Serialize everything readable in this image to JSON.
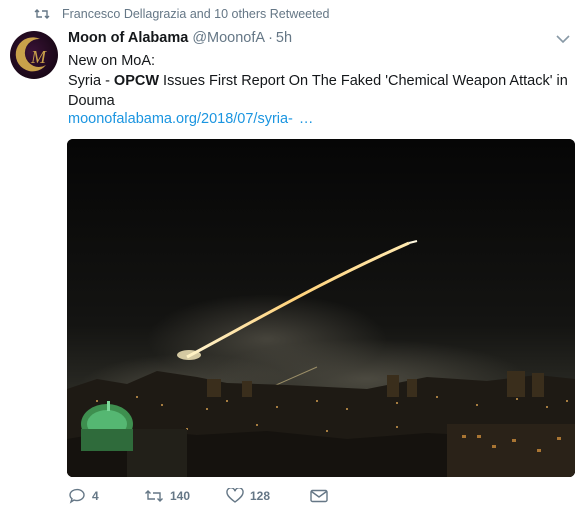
{
  "retweet": {
    "text": "Francesco Dellagrazia and 10 others Retweeted",
    "icon": "retweet-icon"
  },
  "tweet": {
    "display_name": "Moon of Alabama",
    "handle": "@MoonofA",
    "separator": "·",
    "time": "5h",
    "line1": "New on MoA:",
    "line2_prefix": "Syria - ",
    "line2_bold": "OPCW",
    "line2_rest": " Issues First Report On The Faked 'Chemical Weapon Attack' in Douma",
    "link": "moonofalabama.org/2018/07/syria-",
    "link_ellipsis": "…"
  },
  "actions": {
    "reply_count": "4",
    "retweet_count": "140",
    "like_count": "128"
  },
  "colors": {
    "link": "#1b95e0",
    "muted": "#657786",
    "text": "#14171a"
  }
}
